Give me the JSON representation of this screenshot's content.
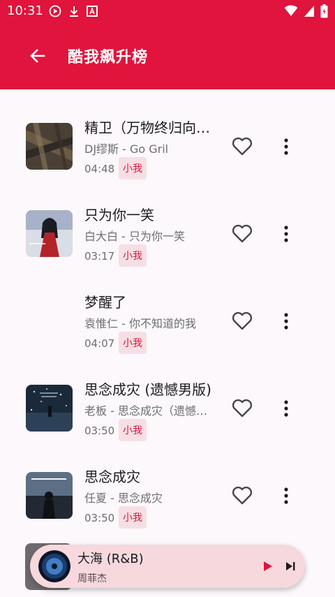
{
  "status_bar": {
    "time": "10:31"
  },
  "app_bar": {
    "title": "酷我飙升榜",
    "back_icon": "arrow-left-icon"
  },
  "songs": [
    {
      "title": "精卫（万物终归向…",
      "subtitle": "DJ缪斯 - Go Gril",
      "duration": "04:48",
      "tag": "小我",
      "has_cover": true
    },
    {
      "title": "只为你一笑",
      "subtitle": "白大白 - 只为你一笑",
      "duration": "03:17",
      "tag": "小我",
      "has_cover": true
    },
    {
      "title": "梦醒了",
      "subtitle": "袁惟仁 - 你不知道的我",
      "duration": "04:07",
      "tag": "小我",
      "has_cover": false
    },
    {
      "title": "思念成灾 (遗憾男版)",
      "subtitle": "老板 - 思念成灾（遗憾…",
      "duration": "03:50",
      "tag": "小我",
      "has_cover": true
    },
    {
      "title": "思念成灾",
      "subtitle": "任夏 - 思念成灾",
      "duration": "03:50",
      "tag": "小我",
      "has_cover": true
    }
  ],
  "mini_player": {
    "title": "大海 (R&B)",
    "artist": "周菲杰",
    "play_icon": "play-icon",
    "next_icon": "skip-next-icon"
  },
  "colors": {
    "accent": "#e0143c",
    "tag_bg": "#f6dfe4",
    "background": "#fcf8fb",
    "mini_player_bg": "#f6d8dd"
  }
}
